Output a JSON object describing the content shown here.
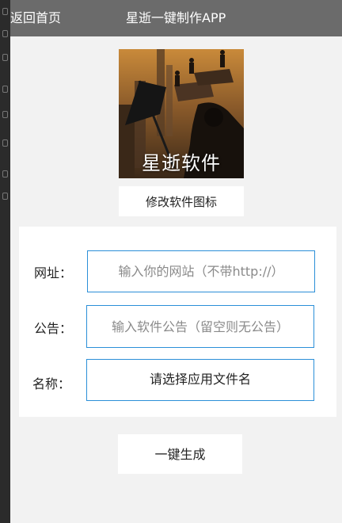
{
  "header": {
    "back_label": "返回首页",
    "title": "星逝一键制作APP"
  },
  "app_icon": {
    "label": "星逝软件",
    "change_button": "修改软件图标"
  },
  "form": {
    "url": {
      "label": "网址：",
      "placeholder": "输入你的网站（不带http://）"
    },
    "notice": {
      "label": "公告：",
      "placeholder": "输入软件公告（留空则无公告）"
    },
    "name": {
      "label": "名称：",
      "value": "请选择应用文件名"
    }
  },
  "actions": {
    "generate": "一键生成"
  },
  "colors": {
    "header_bg": "#6b6b6b",
    "field_border": "#2b8fd8",
    "page_bg": "#f2f2f2"
  }
}
